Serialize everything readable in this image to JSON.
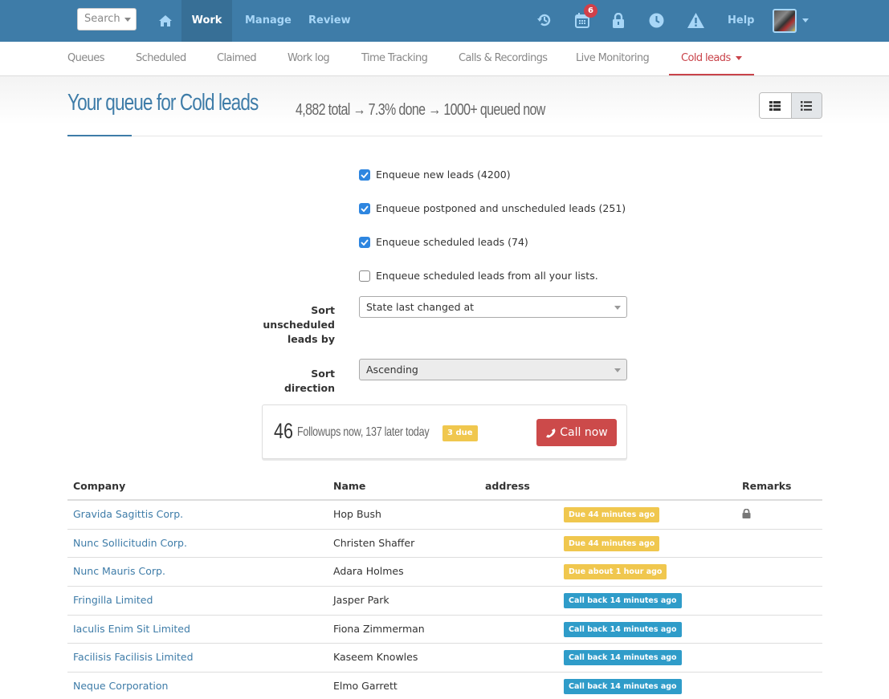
{
  "topbar": {
    "search_placeholder": "Search",
    "nav": [
      {
        "label": "Work",
        "active": true
      },
      {
        "label": "Manage",
        "active": false
      },
      {
        "label": "Review",
        "active": false
      }
    ],
    "icons": [
      "history-icon",
      "calendar-icon",
      "lock-icon",
      "clock-icon",
      "warning-icon"
    ],
    "calendar_badge": "6",
    "help_label": "Help"
  },
  "subnav": {
    "items": [
      {
        "label": "Queues"
      },
      {
        "label": "Scheduled"
      },
      {
        "label": "Claimed"
      },
      {
        "label": "Work log"
      },
      {
        "label": "Time Tracking"
      },
      {
        "label": "Calls & Recordings"
      },
      {
        "label": "Live Monitoring"
      },
      {
        "label": "Cold leads",
        "active": true
      }
    ]
  },
  "header": {
    "title": "Your queue for Cold leads",
    "stats": "4,882 total → 7.3% done → 1000+ queued now"
  },
  "form": {
    "checkboxes": [
      {
        "label": "Enqueue new leads (4200)",
        "checked": true
      },
      {
        "label": "Enqueue postponed and unscheduled leads (251)",
        "checked": true
      },
      {
        "label": "Enqueue scheduled leads (74)",
        "checked": true
      },
      {
        "label": "Enqueue scheduled leads from all your lists.",
        "checked": false
      }
    ],
    "sort_by_label_1": "Sort",
    "sort_by_label_2": "unscheduled",
    "sort_by_label_3": "leads by",
    "sort_by_value": "State last changed at",
    "sort_direction_label": "Sort direction",
    "sort_direction_value": "Ascending"
  },
  "followups": {
    "count": "46",
    "text": "Followups now, 137 later today",
    "due_badge": "3 due",
    "call_button": "Call now"
  },
  "table": {
    "headers": {
      "company": "Company",
      "name": "Name",
      "address": "address",
      "remarks": "Remarks"
    },
    "rows": [
      {
        "company": "Gravida Sagittis Corp.",
        "name": "Hop Bush",
        "status": "Due 44 minutes ago",
        "status_type": "due",
        "remark_lock": true
      },
      {
        "company": "Nunc Sollicitudin Corp.",
        "name": "Christen Shaffer",
        "status": "Due 44 minutes ago",
        "status_type": "due",
        "remark_lock": false
      },
      {
        "company": "Nunc Mauris Corp.",
        "name": "Adara Holmes",
        "status": "Due about 1 hour ago",
        "status_type": "due",
        "remark_lock": false
      },
      {
        "company": "Fringilla Limited",
        "name": "Jasper Park",
        "status": "Call back 14 minutes ago",
        "status_type": "callback",
        "remark_lock": false
      },
      {
        "company": "Iaculis Enim Sit Limited",
        "name": "Fiona Zimmerman",
        "status": "Call back 14 minutes ago",
        "status_type": "callback",
        "remark_lock": false
      },
      {
        "company": "Facilisis Facilisis Limited",
        "name": "Kaseem Knowles",
        "status": "Call back 14 minutes ago",
        "status_type": "callback",
        "remark_lock": false
      },
      {
        "company": "Neque Corporation",
        "name": "Elmo Garrett",
        "status": "Call back 14 minutes ago",
        "status_type": "callback",
        "remark_lock": false
      }
    ]
  },
  "colors": {
    "brand": "#3e7ca8",
    "nav_link": "#a7d6f7",
    "accent_red": "#c9434a",
    "due_yellow": "#f0c74e",
    "callback_blue": "#2f9cc9",
    "checkbox_blue": "#2e86e0"
  }
}
